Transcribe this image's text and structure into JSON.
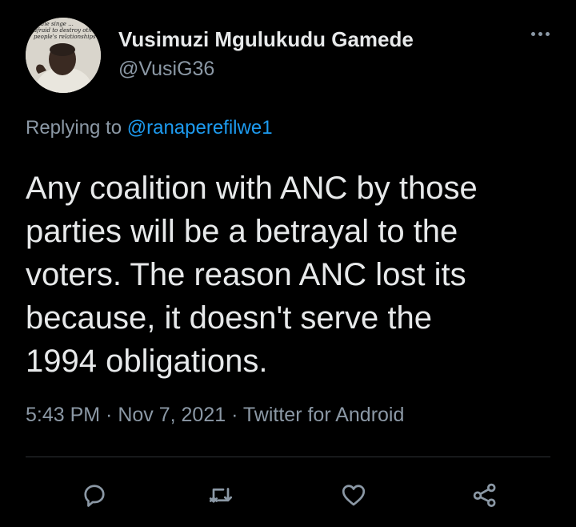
{
  "author": {
    "display_name": "Vusimuzi Mgulukudu Gamede",
    "handle": "@VusiG36",
    "avatar_caption": "... die singe ...\nafraid to destroy oth...\npeople's relationships"
  },
  "reply": {
    "prefix": "Replying to ",
    "mention": "@ranaperefilwe1"
  },
  "tweet": {
    "lines": [
      "Any coalition with ANC by those",
      "parties will be a betrayal to the",
      "voters. The reason ANC lost its",
      "because, it doesn't serve the",
      "1994 obligations."
    ]
  },
  "meta": {
    "text": "5:43 PM · Nov 7, 2021 · Twitter for Android"
  },
  "actions": [
    {
      "name": "reply",
      "icon": "reply-icon"
    },
    {
      "name": "retweet",
      "icon": "retweet-icon"
    },
    {
      "name": "like",
      "icon": "heart-icon"
    },
    {
      "name": "share",
      "icon": "share-icon"
    }
  ],
  "colors": {
    "background": "#000000",
    "primary_text": "#e7e9ea",
    "secondary_text": "#8b98a5",
    "link": "#1d9bf0",
    "divider": "#2f3336"
  }
}
